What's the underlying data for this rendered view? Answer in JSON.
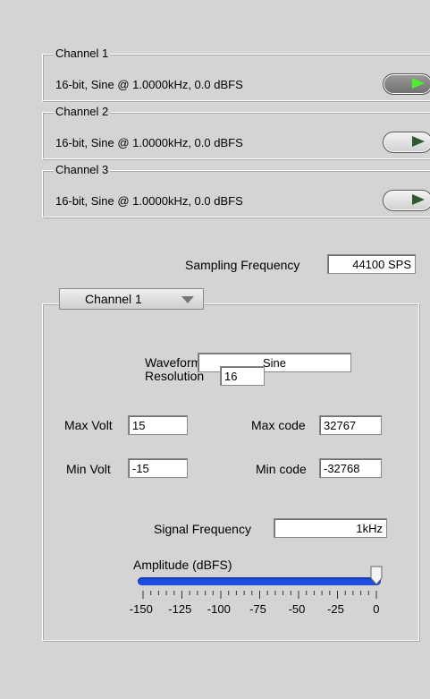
{
  "channels": [
    {
      "legend": "Channel 1",
      "description": "16-bit, Sine @ 1.0000kHz, 0.0 dBFS",
      "led_on": true
    },
    {
      "legend": "Channel 2",
      "description": "16-bit, Sine @ 1.0000kHz, 0.0 dBFS",
      "led_on": false
    },
    {
      "legend": "Channel 3",
      "description": "16-bit, Sine @ 1.0000kHz, 0.0 dBFS",
      "led_on": false
    }
  ],
  "sampling": {
    "label": "Sampling Frequency",
    "value": "44100 SPS"
  },
  "config": {
    "channel_select": "Channel 1",
    "waveform_label": "Waveform",
    "waveform_value": "Sine",
    "resolution_label": "Resolution",
    "resolution_value": "16",
    "max_volt_label": "Max Volt",
    "max_volt_value": "15",
    "max_code_label": "Max code",
    "max_code_value": "32767",
    "min_volt_label": "Min Volt",
    "min_volt_value": "-15",
    "min_code_label": "Min code",
    "min_code_value": "-32768",
    "signal_freq_label": "Signal Frequency",
    "signal_freq_value": "1kHz",
    "amplitude_label": "Amplitude (dBFS)",
    "amplitude_value": 0,
    "amplitude_min": -150,
    "amplitude_max": 0,
    "amplitude_ticks": [
      "-150",
      "-125",
      "-100",
      "-75",
      "-50",
      "-25",
      "0"
    ]
  },
  "colors": {
    "slider": "#1f4fe0",
    "led_on": "#4cf02a",
    "led_off": "#2f5a2f"
  }
}
